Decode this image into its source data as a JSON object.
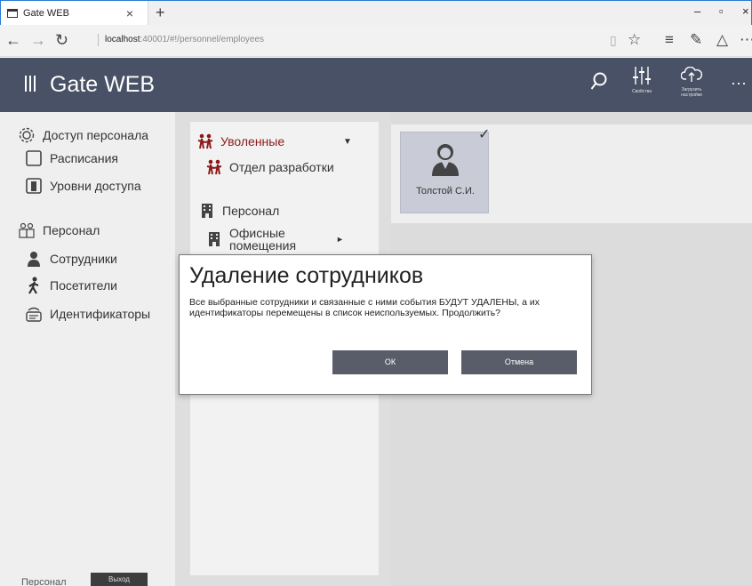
{
  "browser": {
    "tab_title": "Gate WEB",
    "tab_close": "×",
    "new_tab": "+",
    "url_host": "localhost",
    "url_rest": ":40001/#!/personnel/employees",
    "icons": [
      "back-icon",
      "forward-icon",
      "refresh-icon",
      "reading-view-icon",
      "favorites-icon",
      "hub-icon",
      "notes-icon",
      "share-icon",
      "more-icon"
    ]
  },
  "header": {
    "title": "Gate WEB",
    "properties_label": "Свойства",
    "upload_label_1": "Загрузить",
    "upload_label_2": "настройки",
    "more": "···"
  },
  "sidebar": {
    "items": [
      {
        "label": "Доступ персонала",
        "icon": "gear-icon"
      },
      {
        "label": "Расписания",
        "icon": "schedule-icon"
      },
      {
        "label": "Уровни доступа",
        "icon": "door-icon"
      },
      {
        "label": "Персонал",
        "icon": "personnel-icon"
      },
      {
        "label": "Сотрудники",
        "icon": "employee-icon"
      },
      {
        "label": "Посетители",
        "icon": "visitor-icon"
      },
      {
        "label": "Идентификаторы",
        "icon": "id-card-icon"
      }
    ],
    "footer_label": "Персонал",
    "logout_label": "Выход"
  },
  "tree": {
    "items": [
      {
        "label": "Уволенные",
        "icon": "fired-group-icon",
        "arrow": "▼"
      },
      {
        "label": "Отдел разработки",
        "icon": "dept-group-icon"
      },
      {
        "label": "Персонал",
        "icon": "building-icon"
      },
      {
        "label_1": "Офисные",
        "label_2": "помещения",
        "icon": "building-icon",
        "arrow": "►"
      }
    ]
  },
  "employee_card": {
    "name": "Толстой С.И.",
    "check": "✓",
    "icon": "employee-avatar-icon"
  },
  "dialog": {
    "title": "Удаление сотрудников",
    "line_1": "Все выбранные сотрудники и связанные с ними события БУДУТ УДАЛЕНЫ, а их",
    "line_2": "идентификаторы перемещены в список неиспользуемых. Продолжить?",
    "ok_label": "ОК",
    "cancel_label": "Отмена"
  },
  "colors": {
    "header_bg": "#485165",
    "tree_accent": "#8b1a1a",
    "button_bg": "#585d69"
  }
}
